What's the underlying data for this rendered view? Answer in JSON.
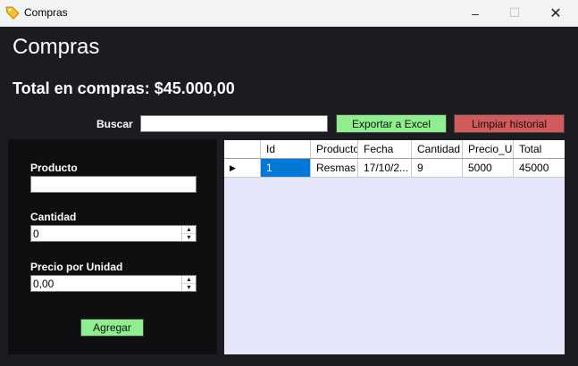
{
  "window": {
    "title": "Compras",
    "icon": "tag-icon",
    "controls": {
      "minimize": "–",
      "maximize": "☐",
      "close": "✕"
    }
  },
  "header": {
    "title": "Compras",
    "total_label": "Total en compras: $45.000,00"
  },
  "toolbar": {
    "search_label": "Buscar",
    "search_value": "",
    "export_label": "Exportar a Excel",
    "clear_label": "Limpiar historial"
  },
  "form": {
    "producto_label": "Producto",
    "producto_value": "",
    "cantidad_label": "Cantidad",
    "cantidad_value": "0",
    "precio_label": "Precio por Unidad",
    "precio_value": "0,00",
    "add_label": "Agregar"
  },
  "table": {
    "columns": [
      "Id",
      "Producto",
      "Fecha",
      "Cantidad",
      "Precio_Ur",
      "Total"
    ],
    "rows": [
      [
        "1",
        "Resmas",
        "17/10/2...",
        "9",
        "5000",
        "45000"
      ]
    ]
  },
  "colors": {
    "background": "#1c1c20",
    "panel": "#0f0f12",
    "export_button": "#8fee8f",
    "clear_button": "#d25a5a",
    "grid_background": "#e6e6fa",
    "selection": "#0078d7"
  }
}
